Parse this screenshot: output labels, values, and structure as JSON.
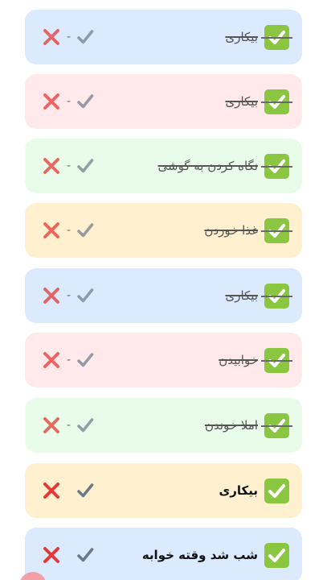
{
  "separator": "-",
  "icons": {
    "delete": "cross-mark-icon",
    "done": "heavy-check-mark-icon",
    "status": "white-heavy-check-mark-icon"
  },
  "colors": {
    "blue": "#dbeafe",
    "pink": "#ffe9ea",
    "green": "#e9fce9",
    "yellow": "#fff1cf",
    "cross_red": "#e53935",
    "check_green": "#8ac640"
  },
  "tasks": [
    {
      "title": "بیکاری",
      "done": true
    },
    {
      "title": "بیکاری",
      "done": true
    },
    {
      "title": "نگاه کردن به گوشی",
      "done": true
    },
    {
      "title": "غذا خوردن",
      "done": true
    },
    {
      "title": "بیکاری",
      "done": true
    },
    {
      "title": "خوابیدن",
      "done": true
    },
    {
      "title": "املا خوندن",
      "done": true
    },
    {
      "title": "بیکاری",
      "done": false
    },
    {
      "title": "شب شد وقته خوابه",
      "done": false
    }
  ]
}
